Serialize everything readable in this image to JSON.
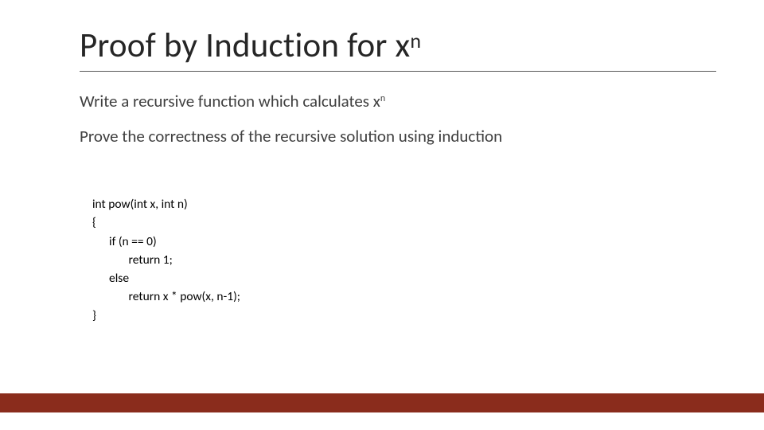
{
  "title": {
    "prefix": "Proof by Induction for x",
    "sup": "n"
  },
  "body": {
    "line1_prefix": "Write a recursive function which calculates x",
    "line1_sup": "n",
    "line2": "Prove the correctness of the  recursive solution using induction"
  },
  "code": {
    "l1": "int pow(int x, int n)",
    "l2": "{",
    "l3": "      if (n == 0)",
    "l4": "             return 1;",
    "l5": "      else",
    "l6": "             return x * pow(x, n-1);",
    "l7": "}"
  },
  "accent_color": "#8a2c1c"
}
